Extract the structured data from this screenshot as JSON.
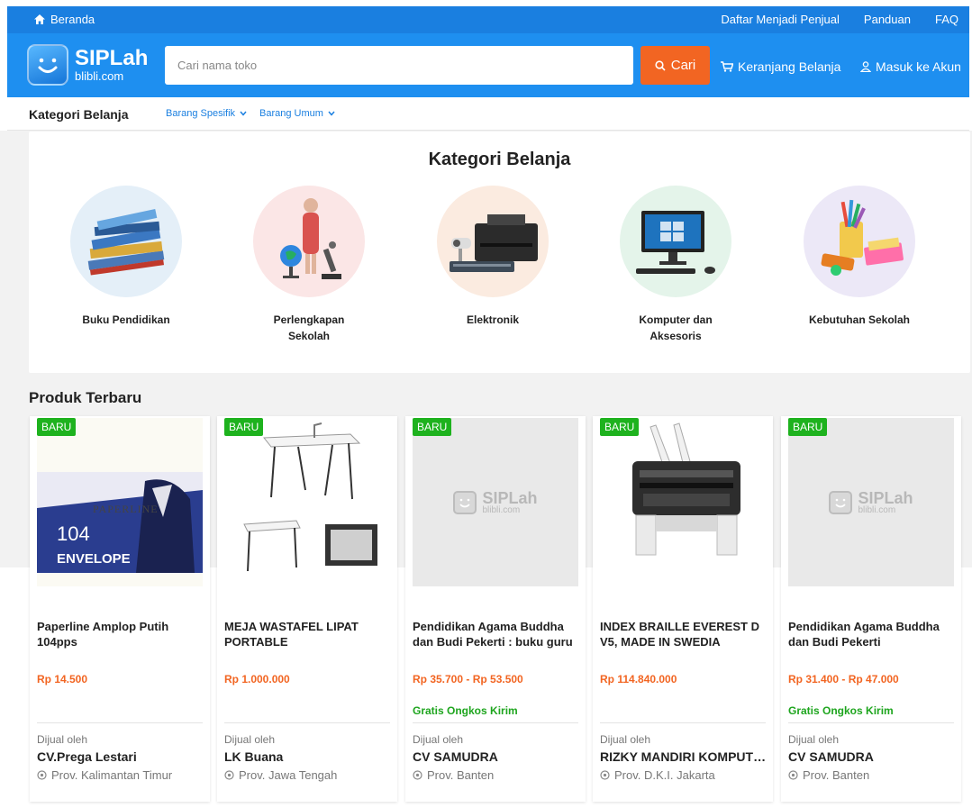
{
  "topbar": {
    "home_label": "Beranda",
    "links": [
      "Daftar Menjadi Penjual",
      "Panduan",
      "FAQ"
    ]
  },
  "header": {
    "logo_main": "SIPLah",
    "logo_sub": "blibli.com",
    "search_placeholder": "Cari nama toko",
    "search_button": "Cari",
    "cart_label": "Keranjang Belanja",
    "login_label": "Masuk ke Akun"
  },
  "catbar": {
    "title": "Kategori Belanja",
    "dropdowns": [
      "Barang Spesifik",
      "Barang Umum"
    ]
  },
  "categories": {
    "heading": "Kategori Belanja",
    "items": [
      {
        "label": "Buku Pendidikan",
        "color": "#e4eff8"
      },
      {
        "label": "Perlengkapan Sekolah",
        "color": "#fbe6e6"
      },
      {
        "label": "Elektronik",
        "color": "#fbebe0"
      },
      {
        "label": "Komputer dan Aksesoris",
        "color": "#e4f4ea"
      },
      {
        "label": "Kebutuhan Sekolah",
        "color": "#ece8f7"
      }
    ]
  },
  "products": {
    "section_title": "Produk Terbaru",
    "badge": "BARU",
    "sold_by": "Dijual oleh",
    "placeholder_main": "SIPLah",
    "placeholder_sub": "blibli.com",
    "items": [
      {
        "name": "Paperline Amplop Putih 104pps",
        "price": "Rp 14.500",
        "shipping": "",
        "seller": "CV.Prega Lestari",
        "location": "Prov. Kalimantan Timur",
        "image_brand": "PAPERLINE",
        "image_count": "104",
        "image_label": "ENVELOPE"
      },
      {
        "name": "MEJA WASTAFEL LIPAT PORTABLE",
        "price": "Rp 1.000.000",
        "shipping": "",
        "seller": "LK Buana",
        "location": "Prov. Jawa Tengah"
      },
      {
        "name": "Pendidikan Agama Buddha dan Budi Pekerti : buku guru",
        "price": "Rp 35.700 - Rp 53.500",
        "shipping": "Gratis Ongkos Kirim",
        "seller": "CV SAMUDRA",
        "location": "Prov. Banten"
      },
      {
        "name": "INDEX BRAILLE EVEREST D V5, MADE IN SWEDIA",
        "price": "Rp 114.840.000",
        "shipping": "",
        "seller": "RIZKY MANDIRI KOMPUTINDO",
        "location": "Prov. D.K.I. Jakarta"
      },
      {
        "name": "Pendidikan Agama Buddha dan Budi Pekerti",
        "price": "Rp 31.400 - Rp 47.000",
        "shipping": "Gratis Ongkos Kirim",
        "seller": "CV SAMUDRA",
        "location": "Prov. Banten"
      }
    ]
  },
  "colors": {
    "primary": "#1e8ff0",
    "accent": "#f26522",
    "success": "#1eb21e"
  }
}
